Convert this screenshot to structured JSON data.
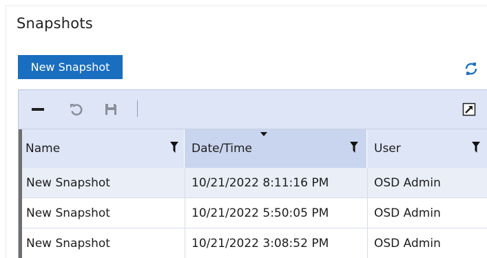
{
  "panel": {
    "title": "Snapshots",
    "new_button_label": "New Snapshot",
    "accent_color": "#1a6ec0"
  },
  "toolbar": {
    "items": [
      {
        "icon": "minus-icon",
        "enabled": true
      },
      {
        "icon": "undo-icon",
        "enabled": false
      },
      {
        "icon": "save-icon",
        "enabled": false
      }
    ],
    "right_icon": "expand-icon"
  },
  "grid": {
    "columns": [
      {
        "label": "Name",
        "filterable": true
      },
      {
        "label": "Date/Time",
        "filterable": true,
        "sorted": "descending"
      },
      {
        "label": "User",
        "filterable": true
      }
    ],
    "rows": [
      {
        "name": "New Snapshot",
        "datetime": "10/21/2022 8:11:16 PM",
        "user": "OSD Admin",
        "selected": true
      },
      {
        "name": "New Snapshot",
        "datetime": "10/21/2022 5:50:05 PM",
        "user": "OSD Admin",
        "selected": false
      },
      {
        "name": "New Snapshot",
        "datetime": "10/21/2022 3:08:52 PM",
        "user": "OSD Admin",
        "selected": false
      }
    ]
  }
}
